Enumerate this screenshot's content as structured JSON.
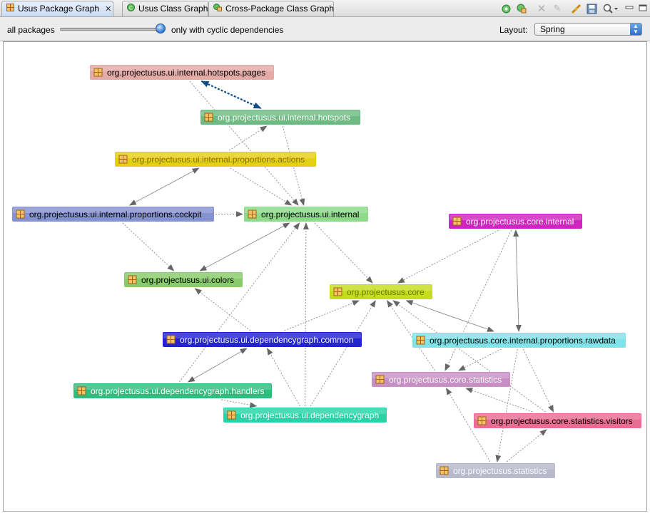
{
  "tabs": [
    {
      "label": "Usus Package Graph",
      "active": true,
      "closable": true,
      "icon": "package-graph-icon"
    },
    {
      "label": "Usus Class Graph",
      "active": false,
      "icon": "class-graph-icon"
    },
    {
      "label": "Cross-Package Class Graph",
      "active": false,
      "icon": "cross-package-icon"
    }
  ],
  "tab_toolbar_icons": [
    "refresh-icon",
    "refresh-all-icon",
    "delete-icon",
    "clear-icon",
    "link-icon",
    "save-icon",
    "zoom-icon",
    "minimize-icon",
    "maximize-icon"
  ],
  "filter": {
    "left_label": "all packages",
    "right_label": "only with cyclic dependencies",
    "value": 1.0
  },
  "layout": {
    "label": "Layout:",
    "selected": "Spring"
  },
  "graph": {
    "nodes": [
      {
        "id": "hotspots_pages",
        "label": "org.projectusus.ui.internal.hotspots.pages",
        "color": "#e3aaa6",
        "text": "#000000"
      },
      {
        "id": "hotspots",
        "label": "org.projectusus.ui.internal.hotspots",
        "color": "#6dbb82",
        "text": "#ffffff"
      },
      {
        "id": "prop_actions",
        "label": "org.projectusus.ui.internal.proportions.actions",
        "color": "#e5d114",
        "text": "#8a6a00"
      },
      {
        "id": "cockpit",
        "label": "org.projectusus.ui.internal.proportions.cockpit",
        "color": "#8592d1",
        "text": "#000000"
      },
      {
        "id": "ui_internal",
        "label": "org.projectusus.ui.internal",
        "color": "#8ddb8a",
        "text": "#000000"
      },
      {
        "id": "core_internal",
        "label": "org.projectusus.core.internal",
        "color": "#cf24c0",
        "text": "#ffffff"
      },
      {
        "id": "colors",
        "label": "org.projectusus.ui.colors",
        "color": "#88cc6a",
        "text": "#000000"
      },
      {
        "id": "core",
        "label": "org.projectusus.core",
        "color": "#c6dd1c",
        "text": "#6a7a00"
      },
      {
        "id": "dg_common",
        "label": "org.projectusus.ui.dependencygraph.common",
        "color": "#2323cf",
        "text": "#ffffff"
      },
      {
        "id": "rawdata",
        "label": "org.projectusus.core.internal.proportions.rawdata",
        "color": "#7fe3e8",
        "text": "#000000"
      },
      {
        "id": "statistics_core",
        "label": "org.projectusus.core.statistics",
        "color": "#c78fc4",
        "text": "#ffffff"
      },
      {
        "id": "dg_handlers",
        "label": "org.projectusus.ui.dependencygraph.handlers",
        "color": "#2fbd7e",
        "text": "#ffffff"
      },
      {
        "id": "dg",
        "label": "org.projectusus.ui.dependencygraph",
        "color": "#26d3a6",
        "text": "#ffffff"
      },
      {
        "id": "visitors",
        "label": "org.projectusus.core.statistics.visitors",
        "color": "#e96c94",
        "text": "#000000"
      },
      {
        "id": "statistics",
        "label": "org.projectusus.statistics",
        "color": "#b8b9cb",
        "text": "#ffffff"
      }
    ],
    "edges": [
      {
        "from": "hotspots_pages",
        "to": "hotspots",
        "style": "cycle"
      },
      {
        "from": "hotspots_pages",
        "to": "ui_internal",
        "style": "dependency"
      },
      {
        "from": "hotspots",
        "to": "ui_internal",
        "style": "dependency"
      },
      {
        "from": "prop_actions",
        "to": "hotspots",
        "style": "dependency"
      },
      {
        "from": "prop_actions",
        "to": "ui_internal",
        "style": "dependency"
      },
      {
        "from": "cockpit",
        "to": "prop_actions",
        "style": "bidirectional"
      },
      {
        "from": "cockpit",
        "to": "ui_internal",
        "style": "dependency"
      },
      {
        "from": "cockpit",
        "to": "colors",
        "style": "dependency"
      },
      {
        "from": "ui_internal",
        "to": "colors",
        "style": "bidirectional"
      },
      {
        "from": "ui_internal",
        "to": "core",
        "style": "dependency"
      },
      {
        "from": "dg_common",
        "to": "colors",
        "style": "dependency"
      },
      {
        "from": "dg_common",
        "to": "core",
        "style": "dependency"
      },
      {
        "from": "dg_common",
        "to": "dg_handlers",
        "style": "bidirectional"
      },
      {
        "from": "dg_handlers",
        "to": "ui_internal",
        "style": "dependency"
      },
      {
        "from": "dg_handlers",
        "to": "dg",
        "style": "dependency"
      },
      {
        "from": "dg",
        "to": "ui_internal",
        "style": "dependency"
      },
      {
        "from": "dg",
        "to": "dg_common",
        "style": "dependency"
      },
      {
        "from": "dg",
        "to": "core",
        "style": "dependency"
      },
      {
        "from": "core_internal",
        "to": "core",
        "style": "dependency"
      },
      {
        "from": "core_internal",
        "to": "rawdata",
        "style": "bidirectional"
      },
      {
        "from": "core_internal",
        "to": "statistics_core",
        "style": "dependency"
      },
      {
        "from": "rawdata",
        "to": "core",
        "style": "bidirectional"
      },
      {
        "from": "rawdata",
        "to": "statistics_core",
        "style": "dependency"
      },
      {
        "from": "rawdata",
        "to": "visitors",
        "style": "dependency"
      },
      {
        "from": "rawdata",
        "to": "statistics",
        "style": "dependency"
      },
      {
        "from": "statistics_core",
        "to": "core",
        "style": "dependency"
      },
      {
        "from": "visitors",
        "to": "core",
        "style": "dependency"
      },
      {
        "from": "visitors",
        "to": "statistics_core",
        "style": "dependency"
      },
      {
        "from": "statistics",
        "to": "statistics_core",
        "style": "dependency"
      },
      {
        "from": "statistics",
        "to": "visitors",
        "style": "dependency"
      }
    ]
  }
}
